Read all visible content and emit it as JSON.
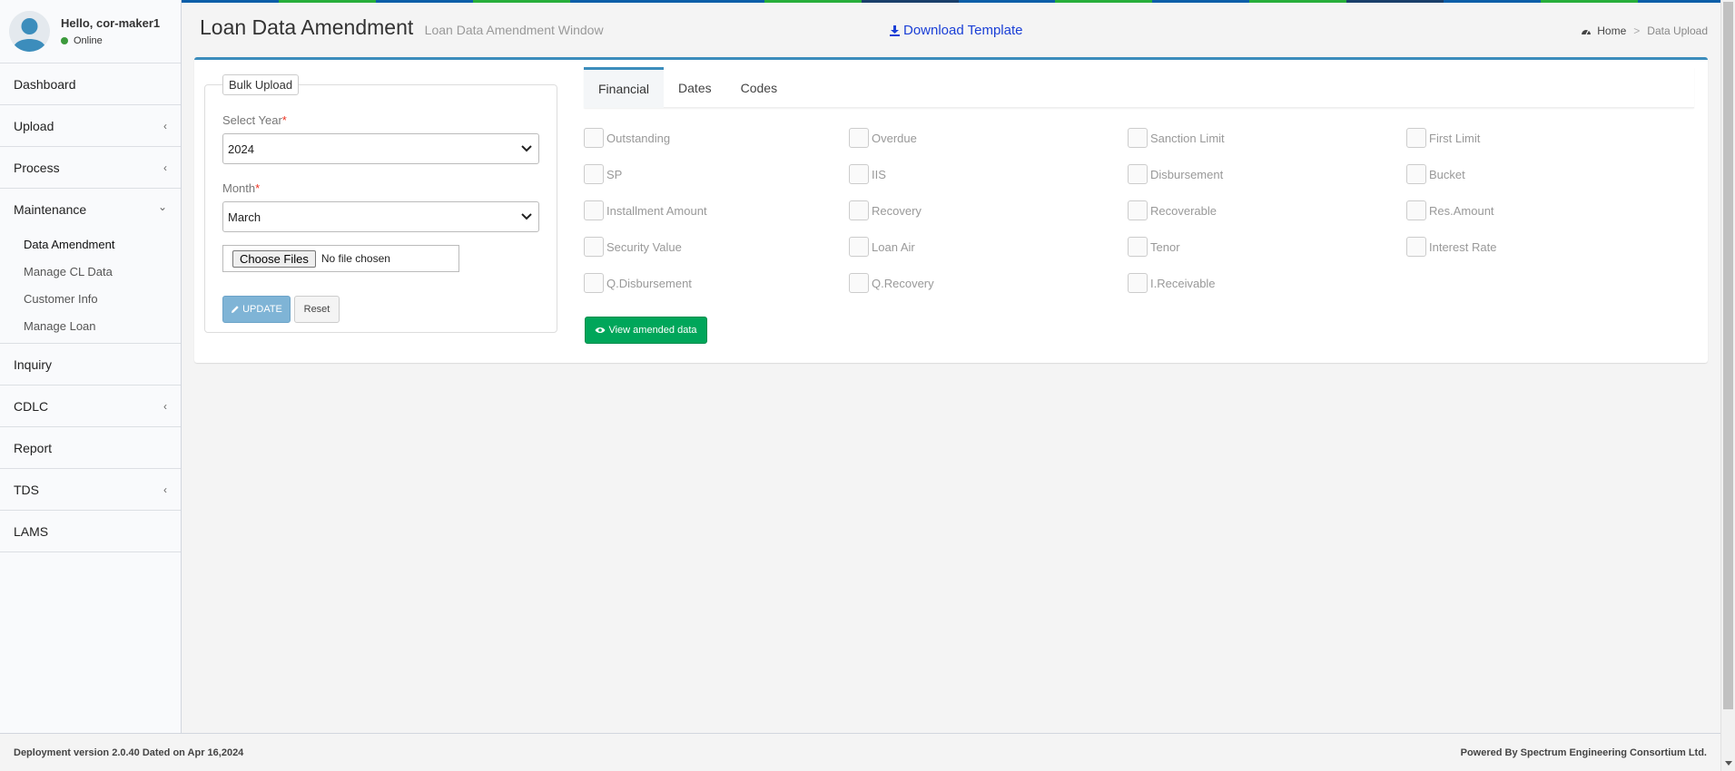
{
  "user": {
    "greeting": "Hello, cor-maker1",
    "status": "Online"
  },
  "sidebar": {
    "items": [
      {
        "label": "Dashboard",
        "chevron": ""
      },
      {
        "label": "Upload",
        "chevron": "‹"
      },
      {
        "label": "Process",
        "chevron": "‹"
      },
      {
        "label": "Maintenance",
        "chevron": "⌄"
      }
    ],
    "submenu": [
      "Data Amendment",
      "Manage CL Data",
      "Customer Info",
      "Manage Loan"
    ],
    "items_after": [
      {
        "label": "Inquiry",
        "chevron": ""
      },
      {
        "label": "CDLC",
        "chevron": "‹"
      },
      {
        "label": "Report",
        "chevron": ""
      },
      {
        "label": "TDS",
        "chevron": "‹"
      },
      {
        "label": "LAMS",
        "chevron": ""
      }
    ]
  },
  "header": {
    "title": "Loan Data Amendment",
    "subtitle": "Loan Data Amendment Window",
    "download_label": "Download Template",
    "breadcrumb_home": "Home",
    "breadcrumb_current": "Data Upload"
  },
  "bulk": {
    "legend": "Bulk Upload",
    "year_label": "Select Year",
    "year_value": "2024",
    "month_label": "Month",
    "month_value": "March",
    "required_mark": "*",
    "file_button": "Choose Files",
    "file_status": "No file chosen",
    "update_label": "UPDATE",
    "reset_label": "Reset"
  },
  "tabs": [
    "Financial",
    "Dates",
    "Codes"
  ],
  "checkboxes": [
    [
      "Outstanding",
      "Overdue",
      "Sanction Limit",
      "First Limit"
    ],
    [
      "SP",
      "IIS",
      "Disbursement",
      "Bucket"
    ],
    [
      "Installment Amount",
      "Recovery",
      "Recoverable",
      "Res.Amount"
    ],
    [
      "Security Value",
      "Loan Air",
      "Tenor",
      "Interest Rate"
    ],
    [
      "Q.Disbursement",
      "Q.Recovery",
      "I.Receivable",
      ""
    ]
  ],
  "view_button": "View amended data",
  "footer": {
    "left": "Deployment version 2.0.40 Dated on Apr 16,2024",
    "right": "Powered By Spectrum Engineering Consortium Ltd."
  },
  "colors": {
    "accent": "#3c8dbc",
    "success": "#00a65a",
    "link": "#1a3fd6",
    "stripe": [
      "#0b5ea8",
      "#27ae3a",
      "#0b5ea8",
      "#27ae3a",
      "#0b5ea8",
      "#0b5ea8",
      "#27ae3a",
      "#1a3f6a",
      "#0b5ea8",
      "#27ae3a",
      "#0b5ea8",
      "#27ae3a",
      "#1a3f6a",
      "#0b5ea8",
      "#27ae3a",
      "#0b5ea8"
    ]
  }
}
